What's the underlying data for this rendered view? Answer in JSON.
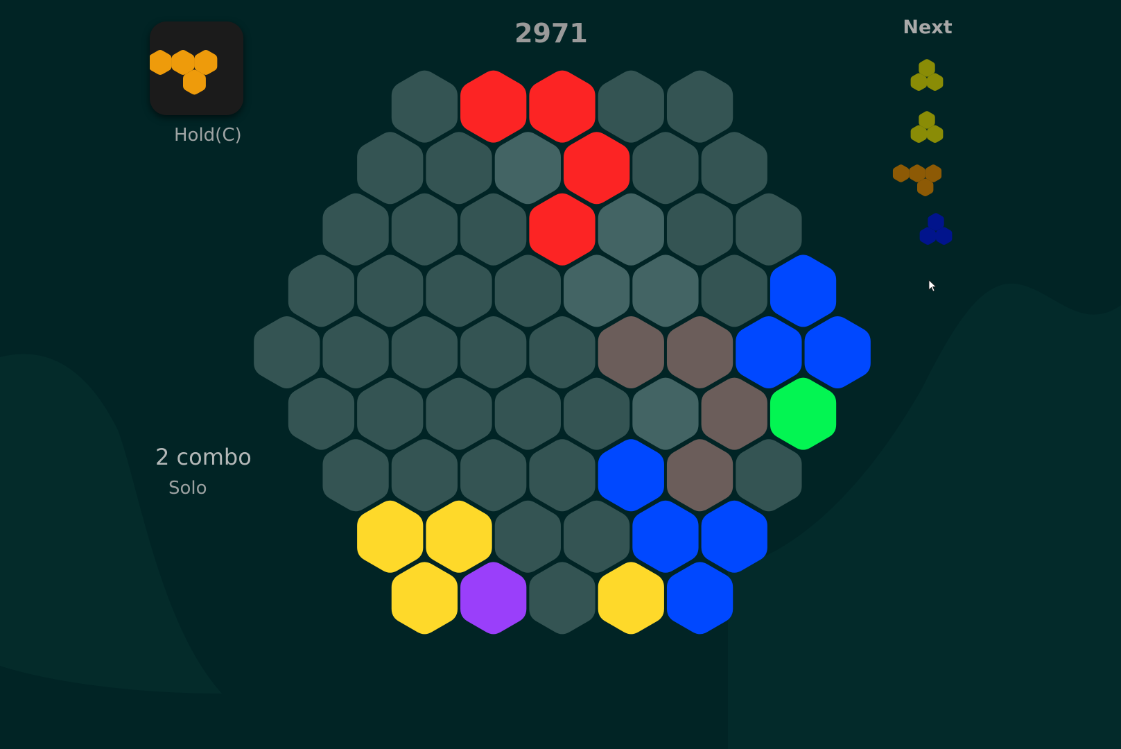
{
  "hud": {
    "score": "2971",
    "hold_label": "Hold(C)",
    "next_label": "Next",
    "combo": "2 combo",
    "mode": "Solo"
  },
  "colors": {
    "background": "#012425",
    "empty_cell": "#345453",
    "empty_cell_light": "#436464",
    "red": "#fc2424",
    "blue": "#0048ff",
    "green": "#03f552",
    "brown": "#6b5d5a",
    "yellow": "#fed92a",
    "purple": "#9a3ffa",
    "hold_orange": "#ee9b0b",
    "next_olive": "#8a8c06",
    "next_brown": "#8d5a05",
    "next_navy": "#01148c"
  },
  "hold_piece": {
    "color": "hold_orange",
    "shape": "triangle-down",
    "icon": "hex-triangle-piece"
  },
  "next_pieces": [
    {
      "color": "next_olive",
      "shape": "triangle-up"
    },
    {
      "color": "next_olive",
      "shape": "triangle-up"
    },
    {
      "color": "next_brown",
      "shape": "triangle-down"
    },
    {
      "color": "next_navy",
      "shape": "triangle-up"
    }
  ],
  "board": {
    "shape": "hexagonal",
    "radius": 4,
    "rows": [
      [
        "empty",
        "red",
        "red",
        "empty",
        "empty"
      ],
      [
        "empty",
        "empty",
        "empty_light",
        "red",
        "empty",
        "empty"
      ],
      [
        "empty",
        "empty",
        "empty",
        "red",
        "empty_light",
        "empty",
        "empty"
      ],
      [
        "empty",
        "empty",
        "empty",
        "empty",
        "empty_light",
        "empty_light",
        "empty",
        "blue"
      ],
      [
        "empty",
        "empty",
        "empty",
        "empty",
        "empty",
        "brown",
        "brown",
        "blue",
        "blue"
      ],
      [
        "empty",
        "empty",
        "empty",
        "empty",
        "empty",
        "empty_light",
        "brown",
        "green"
      ],
      [
        "empty",
        "empty",
        "empty",
        "empty",
        "blue",
        "brown",
        "empty"
      ],
      [
        "yellow",
        "yellow",
        "empty",
        "empty",
        "blue",
        "blue"
      ],
      [
        "yellow",
        "purple",
        "empty",
        "yellow",
        "blue"
      ]
    ]
  }
}
